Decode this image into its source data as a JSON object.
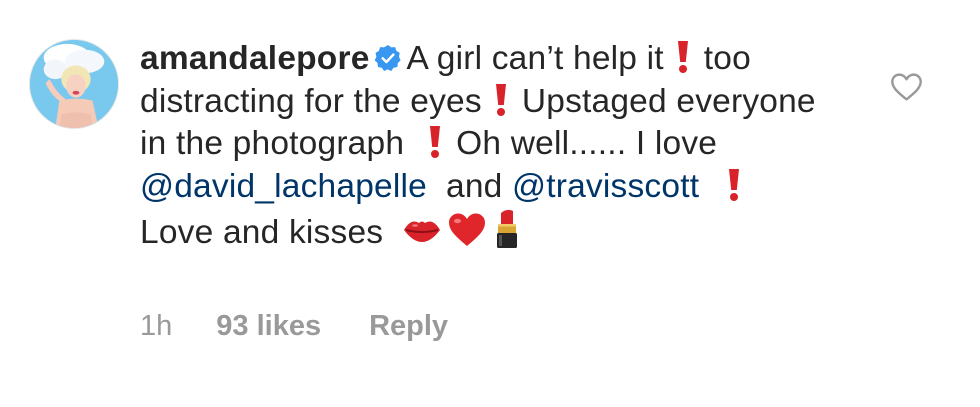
{
  "comment": {
    "username": "amandalepore",
    "segments": {
      "s1": "A girl can’t help it",
      "s2": "too distracting for the eyes",
      "s3": "Upstaged everyone in the photograph",
      "s4": "Oh well...... I love",
      "mention1": "@david_lachapelle",
      "s5": "and",
      "mention2": "@travisscott",
      "s6": "Love and kisses"
    }
  },
  "meta": {
    "time": "1h",
    "likes": "93 likes",
    "reply": "Reply"
  },
  "icons": {
    "verified": "verified-badge-icon",
    "like": "heart-outline-icon",
    "emojis": [
      "exclamation-emoji",
      "kiss-lips-emoji",
      "red-heart-emoji",
      "lipstick-emoji"
    ]
  },
  "colors": {
    "text": "#262626",
    "mention": "#003569",
    "meta": "#999999",
    "verified": "#3897f0",
    "emoji_red": "#d8232a"
  }
}
